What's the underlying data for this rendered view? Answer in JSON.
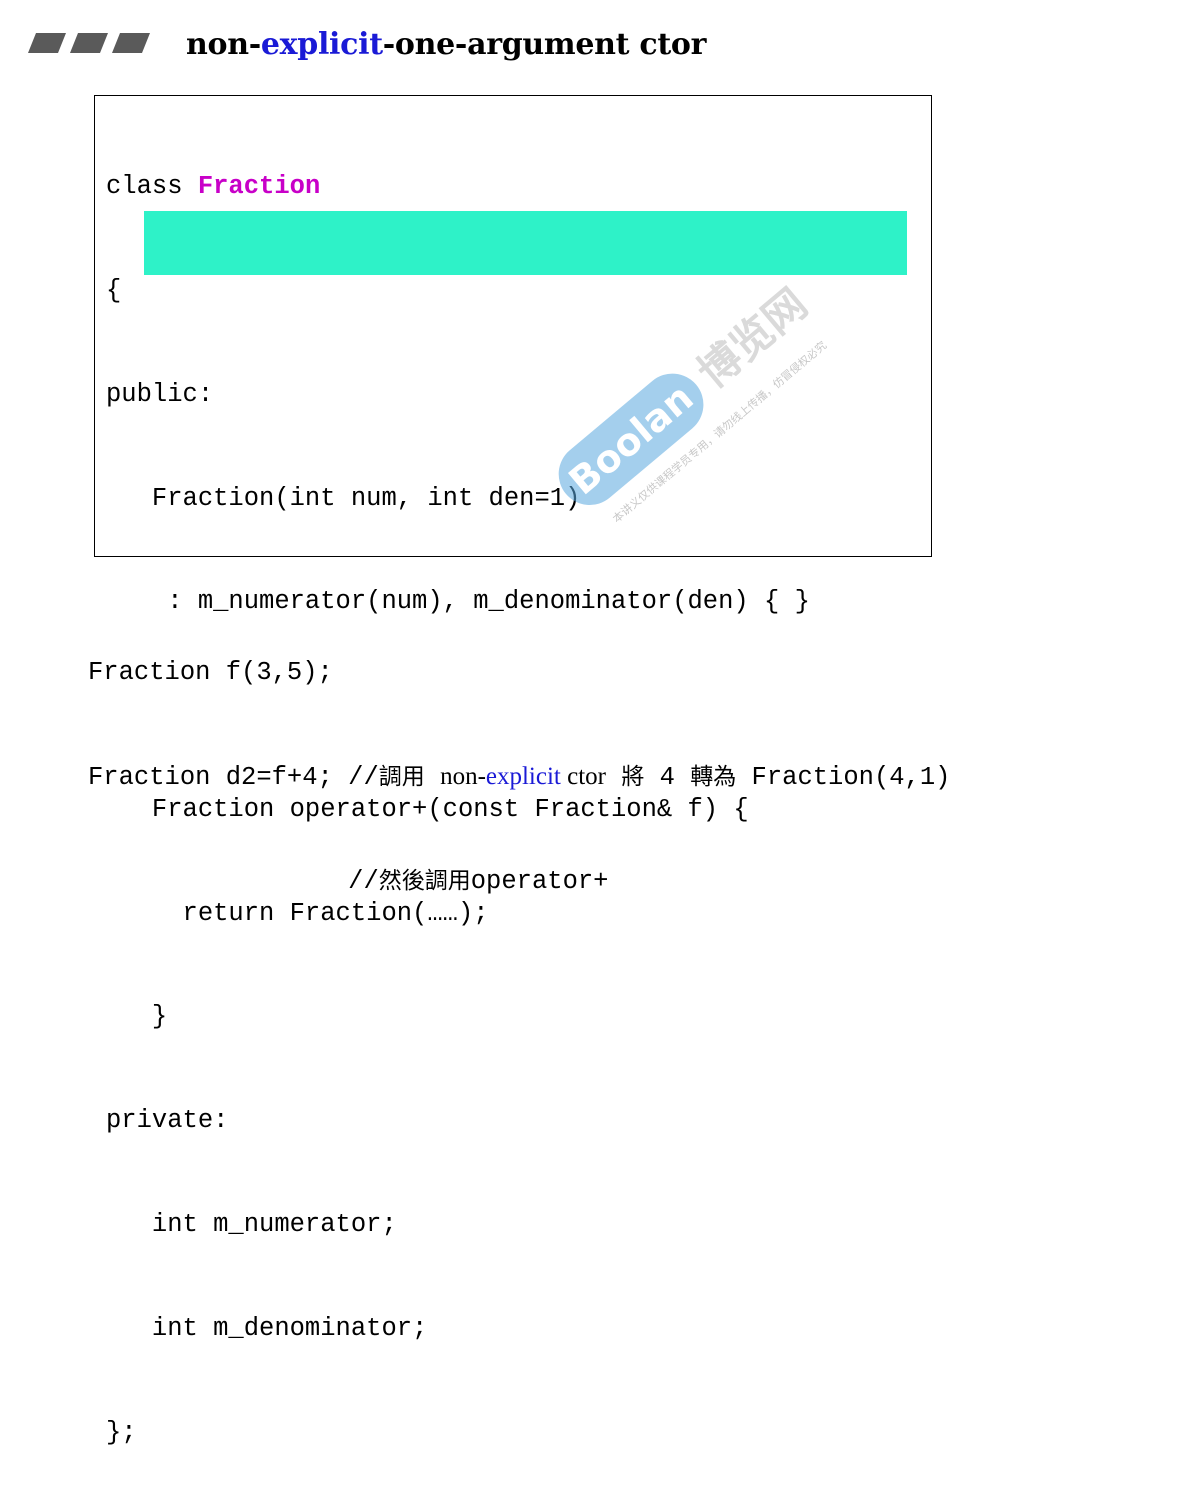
{
  "header": {
    "title_prefix": "non-",
    "title_keyword": "explicit",
    "title_suffix": "-one-argument ctor"
  },
  "code": {
    "l1_kw": "class ",
    "l1_name": "Fraction",
    "l2": "{",
    "l3": "public:",
    "l4": "   Fraction(int num, int den=1)",
    "l5": "    : m_numerator(num), m_denominator(den) { }",
    "l6": "",
    "l7": "   Fraction operator+(const Fraction& f) {",
    "l8": "     return Fraction(……);",
    "l9": "   }",
    "l10": "private:",
    "l11": "   int m_numerator;",
    "l12": "   int m_denominator;",
    "l13": "};"
  },
  "usage": {
    "line1": "Fraction f(3,5);",
    "line2_code": "Fraction d2=f+4; //",
    "line2_cjk1": "調用",
    "line2_sp": " ",
    "line2_serif_a": "non-",
    "line2_serif_kw": "explicit",
    "line2_serif_b": " ctor",
    "line2_sp2": " ",
    "line2_cjk2": "將",
    "line2_mid": " 4 ",
    "line2_cjk3": "轉為",
    "line2_end": " Fraction(4,1)",
    "line3_indent": "                 //",
    "line3_cjk": "然後調用",
    "line3_code": "operator+"
  },
  "watermark": {
    "brand": "Boolan",
    "cn_brand": "博览网",
    "notice": "本讲义仅供课程学员专用，请勿线上传播，仿冒侵权必究"
  },
  "colors": {
    "keyword_blue": "#1a1ad6",
    "class_name_magenta": "#c800c8",
    "highlight": "#2ef2c8",
    "watermark_blue": "#5aa9e0"
  }
}
